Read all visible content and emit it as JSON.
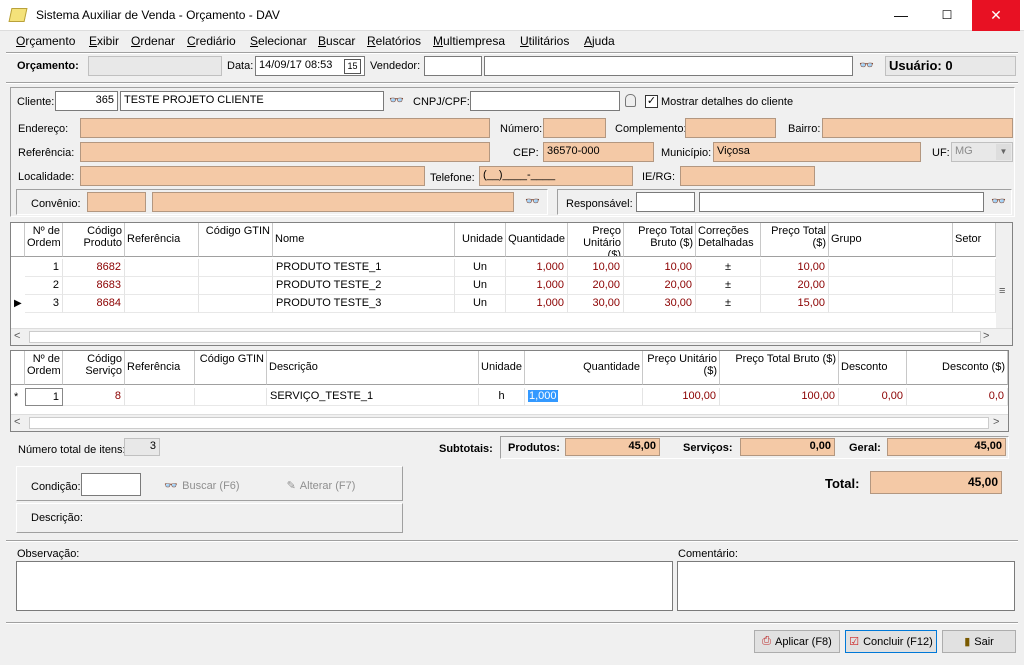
{
  "window": {
    "title": "Sistema Auxiliar de Venda - Orçamento - DAV",
    "min": "—",
    "max": "☐",
    "close": "✕"
  },
  "menu": [
    "Orçamento",
    "Exibir",
    "Ordenar",
    "Crediário",
    "Selecionar",
    "Buscar",
    "Relatórios",
    "Multiempresa",
    "Utilitários",
    "Ajuda"
  ],
  "header": {
    "orcamento_label": "Orçamento:",
    "orcamento_value": "",
    "data_label": "Data:",
    "data_value": "14/09/17 08:53",
    "vendedor_label": "Vendedor:",
    "vendedor_code": "",
    "vendedor_name": "",
    "usuario": "Usuário: 0"
  },
  "client": {
    "cliente_label": "Cliente:",
    "cliente_code": "365",
    "cliente_name": "TESTE PROJETO CLIENTE",
    "cnpj_label": "CNPJ/CPF:",
    "cnpj_value": "",
    "mostrar_label": "Mostrar detalhes do cliente",
    "mostrar_checked": "✓",
    "endereco_label": "Endereço:",
    "numero_label": "Número:",
    "complemento_label": "Complemento:",
    "bairro_label": "Bairro:",
    "referencia_label": "Referência:",
    "cep_label": "CEP:",
    "cep_value": "36570-000",
    "municipio_label": "Município:",
    "municipio_value": "Viçosa",
    "uf_label": "UF:",
    "uf_value": "MG",
    "localidade_label": "Localidade:",
    "telefone_label": "Telefone:",
    "telefone_value": "(__)____-____",
    "ie_label": "IE/RG:",
    "convenio_label": "Convênio:",
    "responsavel_label": "Responsável:"
  },
  "products": {
    "headers": [
      "Nº de Ordem",
      "Código Produto",
      "Referência",
      "Código GTIN",
      "Nome",
      "Unidade",
      "Quantidade",
      "Preço Unitário ($)",
      "Preço Total Bruto ($)",
      "Correções Detalhadas",
      "Preço Total ($)",
      "Grupo",
      "Setor"
    ],
    "rows": [
      {
        "ordem": "1",
        "codigo": "8682",
        "ref": "",
        "gtin": "",
        "nome": "PRODUTO TESTE_1",
        "unidade": "Un",
        "qtd": "1,000",
        "unit": "10,00",
        "bruto": "10,00",
        "corr": "±",
        "total": "10,00",
        "grupo": "",
        "setor": ""
      },
      {
        "ordem": "2",
        "codigo": "8683",
        "ref": "",
        "gtin": "",
        "nome": "PRODUTO TESTE_2",
        "unidade": "Un",
        "qtd": "1,000",
        "unit": "20,00",
        "bruto": "20,00",
        "corr": "±",
        "total": "20,00",
        "grupo": "",
        "setor": ""
      },
      {
        "ordem": "3",
        "codigo": "8684",
        "ref": "",
        "gtin": "",
        "nome": "PRODUTO TESTE_3",
        "unidade": "Un",
        "qtd": "1,000",
        "unit": "30,00",
        "bruto": "30,00",
        "corr": "±",
        "total": "15,00",
        "grupo": "",
        "setor": ""
      }
    ]
  },
  "services": {
    "headers": [
      "Nº de Ordem",
      "Código Serviço",
      "Referência",
      "Código GTIN",
      "Descrição",
      "Unidade",
      "Quantidade",
      "Preço Unitário ($)",
      "Preço Total Bruto ($)",
      "Desconto (%)",
      "Desconto ($)"
    ],
    "rows": [
      {
        "ordem": "1",
        "codigo": "8",
        "ref": "",
        "gtin": "",
        "desc": "SERVIÇO_TESTE_1",
        "unidade": "h",
        "qtd": "1,000",
        "unit": "100,00",
        "bruto": "100,00",
        "desc_pct": "0,00",
        "desc_val": "0,0"
      }
    ]
  },
  "totals": {
    "num_itens_label": "Número total de itens:",
    "num_itens": "3",
    "subtotais_label": "Subtotais:",
    "produtos_label": "Produtos:",
    "produtos": "45,00",
    "servicos_label": "Serviços:",
    "servicos": "0,00",
    "geral_label": "Geral:",
    "geral": "45,00",
    "total_label": "Total:",
    "total": "45,00"
  },
  "condicao": {
    "label": "Condição:",
    "value": "",
    "buscar": "Buscar (F6)",
    "alterar": "Alterar (F7)",
    "descricao_label": "Descrição:"
  },
  "notes": {
    "observacao_label": "Observação:",
    "comentario_label": "Comentário:"
  },
  "buttons": {
    "aplicar": "Aplicar (F8)",
    "concluir": "Concluir (F12)",
    "sair": "Sair"
  }
}
